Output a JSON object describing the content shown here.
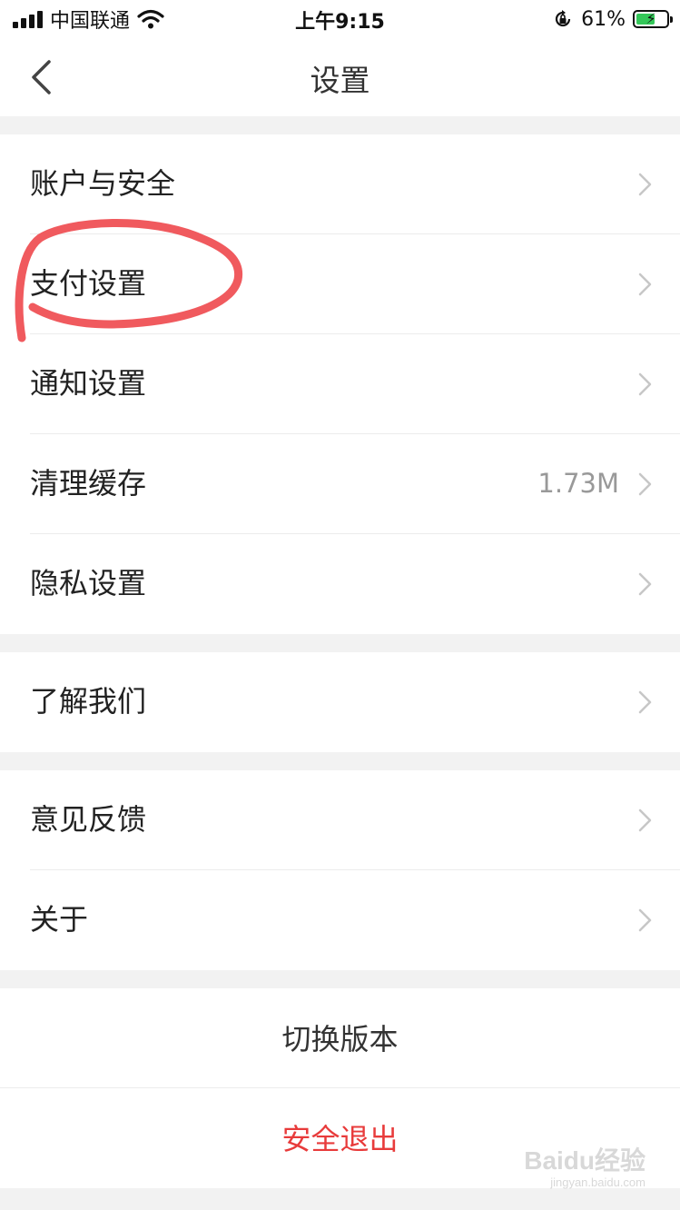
{
  "status_bar": {
    "carrier": "中国联通",
    "time": "上午9:15",
    "battery_percent": "61%",
    "battery_level": 0.61,
    "icons": [
      "signal-bars-icon",
      "wifi-icon",
      "orientation-lock-icon",
      "battery-charging-icon"
    ]
  },
  "nav": {
    "title": "设置",
    "back_icon": "chevron-left-icon"
  },
  "groups": [
    {
      "items": [
        {
          "label": "账户与安全",
          "value": ""
        },
        {
          "label": "支付设置",
          "value": ""
        },
        {
          "label": "通知设置",
          "value": ""
        },
        {
          "label": "清理缓存",
          "value": "1.73M"
        },
        {
          "label": "隐私设置",
          "value": ""
        }
      ]
    },
    {
      "items": [
        {
          "label": "了解我们",
          "value": ""
        }
      ]
    },
    {
      "items": [
        {
          "label": "意见反馈",
          "value": ""
        },
        {
          "label": "关于",
          "value": ""
        }
      ]
    }
  ],
  "actions": {
    "switch_version": "切换版本",
    "logout": "安全退出"
  },
  "colors": {
    "logout_text": "#e83b3b",
    "annotation_circle": "#f05a5e",
    "background": "#f2f2f2",
    "chevron": "#c7c7c7"
  },
  "watermark": {
    "main": "Baidu经验",
    "sub": "jingyan.baidu.com"
  }
}
